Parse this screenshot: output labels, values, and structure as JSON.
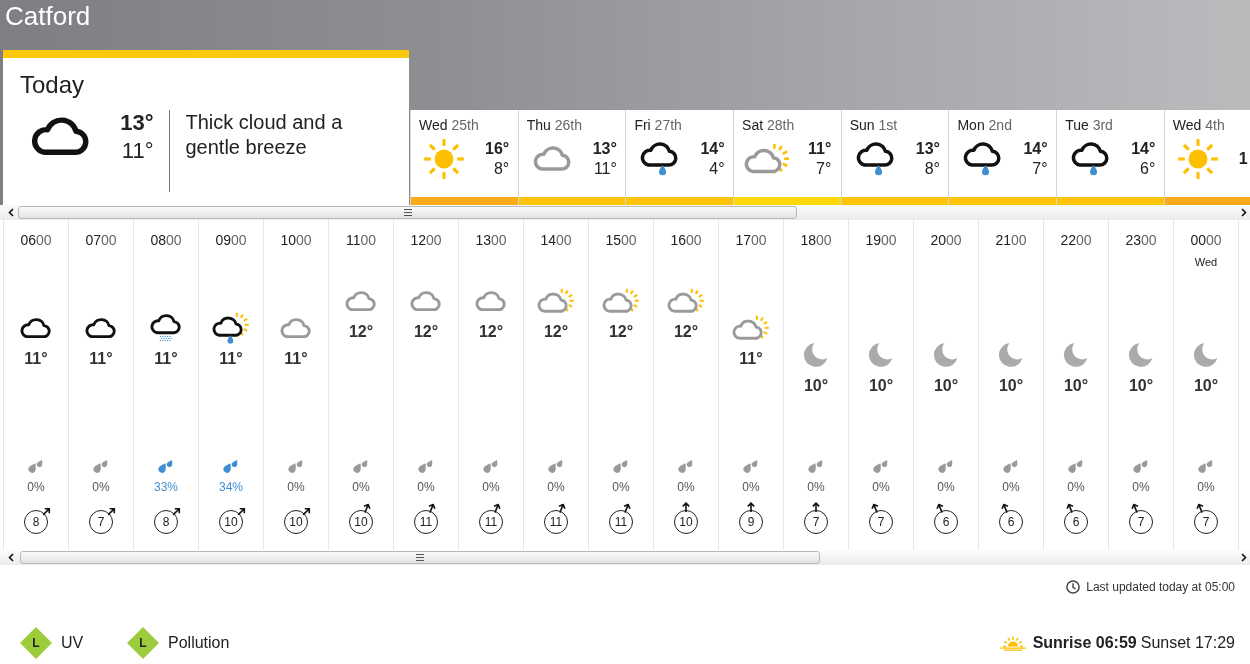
{
  "location": "Catford",
  "today": {
    "title": "Today",
    "kind": "cloud",
    "high": "13°",
    "low": "11°",
    "description": "Thick cloud and a gentle breeze"
  },
  "days": [
    {
      "day": "Wed",
      "date": "25th",
      "kind": "sun",
      "high": "16°",
      "low": "8°",
      "color": "#f9ab1c"
    },
    {
      "day": "Thu",
      "date": "26th",
      "kind": "lightcloud",
      "high": "13°",
      "low": "11°",
      "color": "#fcc40d"
    },
    {
      "day": "Fri",
      "date": "27th",
      "kind": "rain",
      "high": "14°",
      "low": "4°",
      "color": "#fcc40d"
    },
    {
      "day": "Sat",
      "date": "28th",
      "kind": "suncloud",
      "high": "11°",
      "low": "7°",
      "color": "#fdd80a"
    },
    {
      "day": "Sun",
      "date": "1st",
      "kind": "rain",
      "high": "13°",
      "low": "8°",
      "color": "#fcc40d"
    },
    {
      "day": "Mon",
      "date": "2nd",
      "kind": "rain",
      "high": "14°",
      "low": "7°",
      "color": "#fcc40d"
    },
    {
      "day": "Tue",
      "date": "3rd",
      "kind": "rain",
      "high": "14°",
      "low": "6°",
      "color": "#fcc40d"
    },
    {
      "day": "Wed",
      "date": "4th",
      "kind": "sun",
      "high": "1",
      "color": "#f9ab1c"
    }
  ],
  "hours": [
    {
      "hour": "06",
      "minutes": "00",
      "kind": "cloud",
      "temperature": "11°",
      "rain_chance": "0%",
      "rain_expected": false,
      "wind": {
        "speed": "8",
        "kind": "ne"
      }
    },
    {
      "hour": "07",
      "minutes": "00",
      "kind": "cloud",
      "temperature": "11°",
      "rain_chance": "0%",
      "rain_expected": false,
      "wind": {
        "speed": "7",
        "kind": "ne"
      }
    },
    {
      "hour": "08",
      "minutes": "00",
      "kind": "drizzle",
      "temperature": "11°",
      "rain_chance": "33%",
      "rain_expected": true,
      "wind": {
        "speed": "8",
        "kind": "ne"
      }
    },
    {
      "hour": "09",
      "minutes": "00",
      "kind": "sunrain",
      "temperature": "11°",
      "rain_chance": "34%",
      "rain_expected": true,
      "wind": {
        "speed": "10",
        "kind": "ne"
      }
    },
    {
      "hour": "10",
      "minutes": "00",
      "kind": "lightcloud",
      "temperature": "11°",
      "rain_chance": "0%",
      "rain_expected": false,
      "wind": {
        "speed": "10",
        "kind": "ne"
      }
    },
    {
      "hour": "11",
      "minutes": "00",
      "kind": "lightcloud",
      "temperature": "12°",
      "rain_chance": "0%",
      "rain_expected": false,
      "wind": {
        "speed": "10",
        "kind": "nne"
      }
    },
    {
      "hour": "12",
      "minutes": "00",
      "kind": "lightcloud",
      "temperature": "12°",
      "rain_chance": "0%",
      "rain_expected": false,
      "wind": {
        "speed": "11",
        "kind": "nne"
      }
    },
    {
      "hour": "13",
      "minutes": "00",
      "kind": "lightcloud",
      "temperature": "12°",
      "rain_chance": "0%",
      "rain_expected": false,
      "wind": {
        "speed": "11",
        "kind": "nne"
      }
    },
    {
      "hour": "14",
      "minutes": "00",
      "kind": "suncloud",
      "temperature": "12°",
      "rain_chance": "0%",
      "rain_expected": false,
      "wind": {
        "speed": "11",
        "kind": "nne"
      }
    },
    {
      "hour": "15",
      "minutes": "00",
      "kind": "suncloud",
      "temperature": "12°",
      "rain_chance": "0%",
      "rain_expected": false,
      "wind": {
        "speed": "11",
        "kind": "nne"
      }
    },
    {
      "hour": "16",
      "minutes": "00",
      "kind": "suncloud",
      "temperature": "12°",
      "rain_chance": "0%",
      "rain_expected": false,
      "wind": {
        "speed": "10",
        "kind": "n"
      }
    },
    {
      "hour": "17",
      "minutes": "00",
      "kind": "suncloud",
      "temperature": "11°",
      "rain_chance": "0%",
      "rain_expected": false,
      "wind": {
        "speed": "9",
        "kind": "n"
      }
    },
    {
      "hour": "18",
      "minutes": "00",
      "kind": "moon",
      "temperature": "10°",
      "rain_chance": "0%",
      "rain_expected": false,
      "wind": {
        "speed": "7",
        "kind": "n"
      }
    },
    {
      "hour": "19",
      "minutes": "00",
      "kind": "moon",
      "temperature": "10°",
      "rain_chance": "0%",
      "rain_expected": false,
      "wind": {
        "speed": "7",
        "kind": "nnw"
      }
    },
    {
      "hour": "20",
      "minutes": "00",
      "kind": "moon",
      "temperature": "10°",
      "rain_chance": "0%",
      "rain_expected": false,
      "wind": {
        "speed": "6",
        "kind": "nnw"
      }
    },
    {
      "hour": "21",
      "minutes": "00",
      "kind": "moon",
      "temperature": "10°",
      "rain_chance": "0%",
      "rain_expected": false,
      "wind": {
        "speed": "6",
        "kind": "nnw"
      }
    },
    {
      "hour": "22",
      "minutes": "00",
      "kind": "moon",
      "temperature": "10°",
      "rain_chance": "0%",
      "rain_expected": false,
      "wind": {
        "speed": "6",
        "kind": "nnw"
      }
    },
    {
      "hour": "23",
      "minutes": "00",
      "kind": "moon",
      "temperature": "10°",
      "rain_chance": "0%",
      "rain_expected": false,
      "wind": {
        "speed": "7",
        "kind": "nnw"
      }
    },
    {
      "hour": "00",
      "minutes": "00",
      "day": "Wed",
      "kind": "moon",
      "temperature": "10°",
      "rain_chance": "0%",
      "rain_expected": false,
      "wind": {
        "speed": "7",
        "kind": "nnw"
      }
    }
  ],
  "last_updated": "Last updated today at 05:00",
  "indices": [
    {
      "grade": "L",
      "label": "UV",
      "color": "#9ccb3b"
    },
    {
      "grade": "L",
      "label": "Pollution",
      "color": "#9ccb3b"
    }
  ],
  "sunrise": "Sunrise 06:59",
  "sunset": "Sunset 17:29"
}
